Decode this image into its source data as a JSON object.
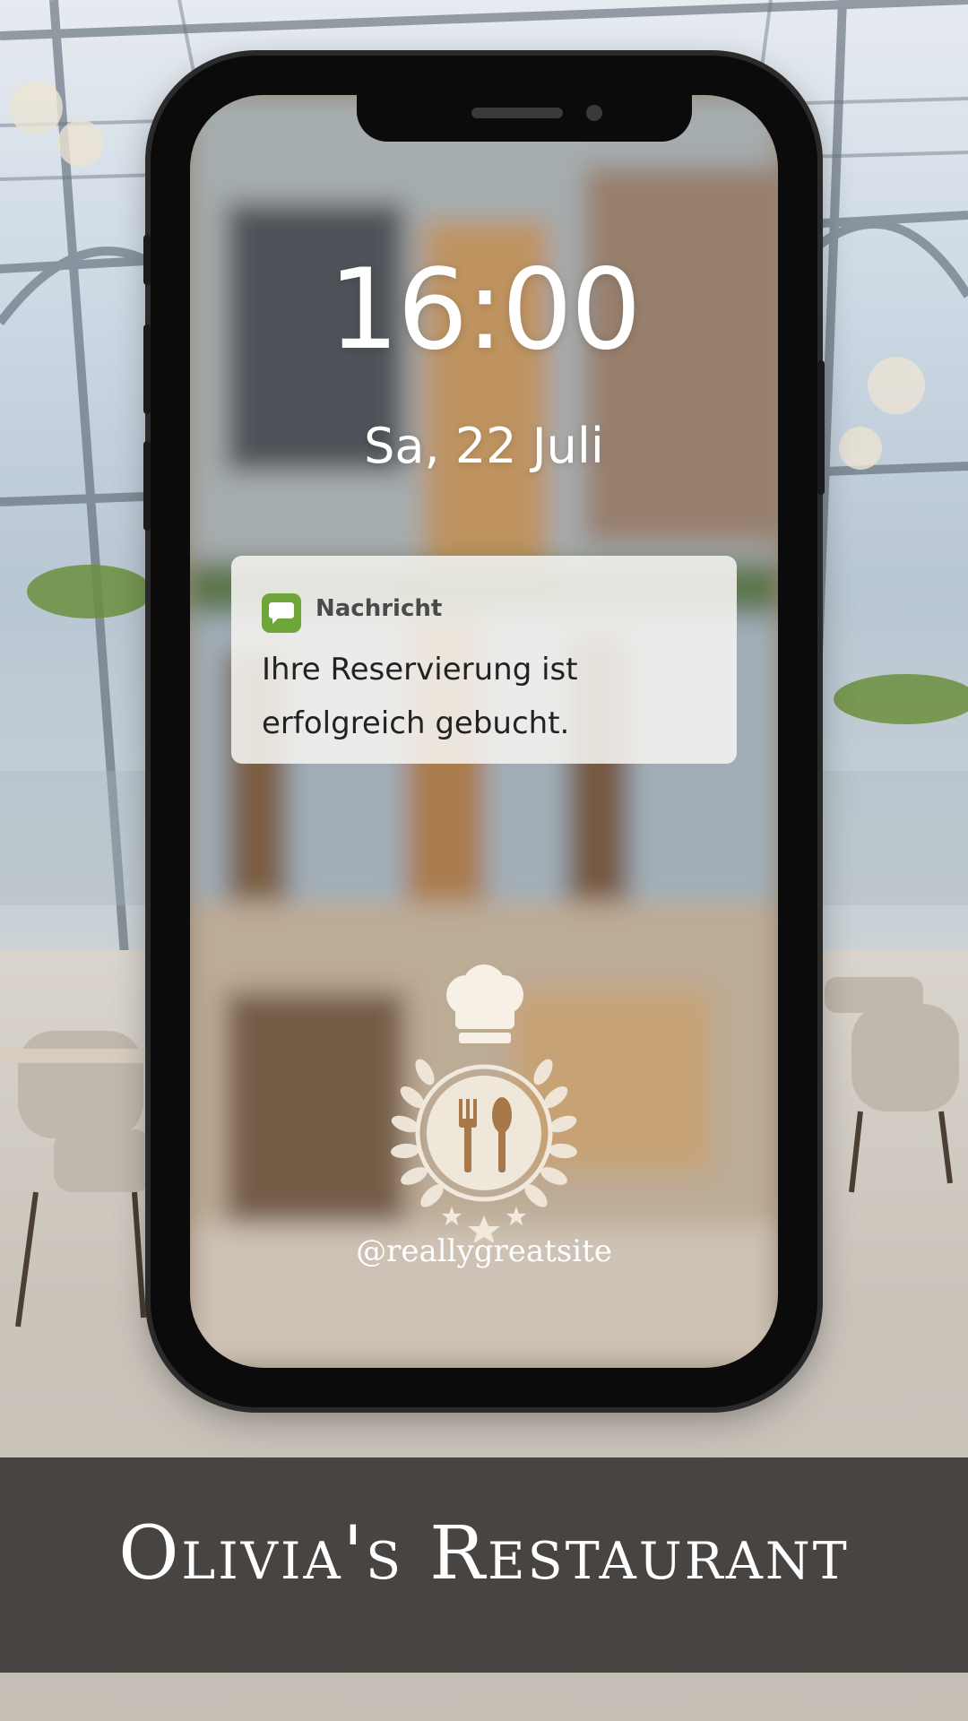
{
  "lockscreen": {
    "time": "16:00",
    "date": "Sa, 22 Juli"
  },
  "notification": {
    "app_name": "Nachricht",
    "icon": "message-bubble-icon",
    "message": "Ihre Reservierung ist erfolgreich gebucht.",
    "icon_color": "#6ea63a"
  },
  "logo": {
    "icon": "chef-hat-fork-spoon-wreath-icon"
  },
  "social_handle": "@reallygreatsite",
  "banner": {
    "title": "Olivia's Restaurant",
    "background_color": "#474441"
  }
}
